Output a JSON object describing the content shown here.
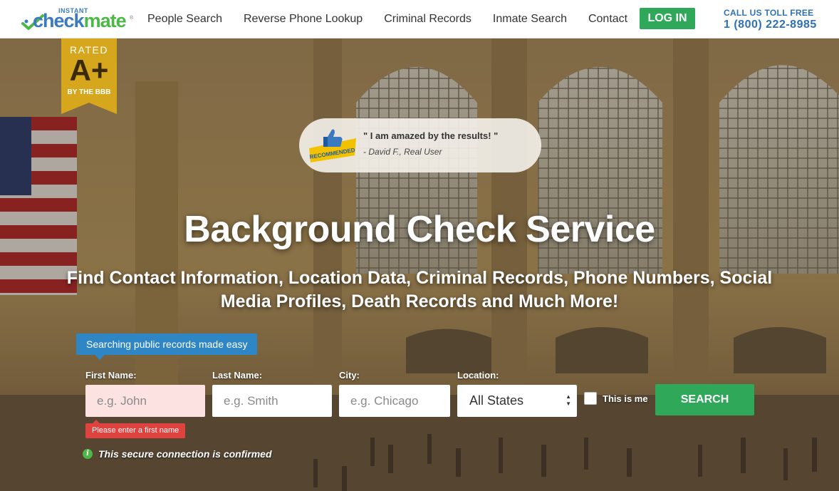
{
  "header": {
    "logo": {
      "small": "INSTANT",
      "part1": "check",
      "part2": "mate",
      "tm": "®"
    },
    "nav": [
      "People Search",
      "Reverse Phone Lookup",
      "Criminal Records",
      "Inmate Search",
      "Contact"
    ],
    "login_label": "LOG IN",
    "toll_label": "CALL US TOLL FREE",
    "toll_number": "1 (800) 222-8985"
  },
  "bbb": {
    "rated": "RATED",
    "grade": "A+",
    "by": "BY THE BBB"
  },
  "testimonial": {
    "badge": "RECOMMENDED",
    "quote": "\" I am amazed by the results! \"",
    "author": "- David F., Real User"
  },
  "hero": {
    "title": "Background Check Service",
    "subtitle": "Find Contact Information, Location Data, Criminal Records, Phone Numbers, Social Media Profiles, Death Records and Much More!"
  },
  "form": {
    "tooltip": "Searching public records made easy",
    "first_name": {
      "label": "First Name:",
      "placeholder": "e.g. John"
    },
    "last_name": {
      "label": "Last Name:",
      "placeholder": "e.g. Smith"
    },
    "city": {
      "label": "City:",
      "placeholder": "e.g. Chicago"
    },
    "location": {
      "label": "Location:",
      "value": "All States"
    },
    "this_is_me": "This is me",
    "search_label": "SEARCH",
    "error": "Please enter a first name",
    "secure": "This secure connection is confirmed"
  },
  "colors": {
    "brand_blue": "#3a7bbf",
    "brand_green": "#4db848",
    "button_green": "#2fa85a",
    "error_red": "#e0433f",
    "tooltip_blue": "#2e86c4"
  }
}
